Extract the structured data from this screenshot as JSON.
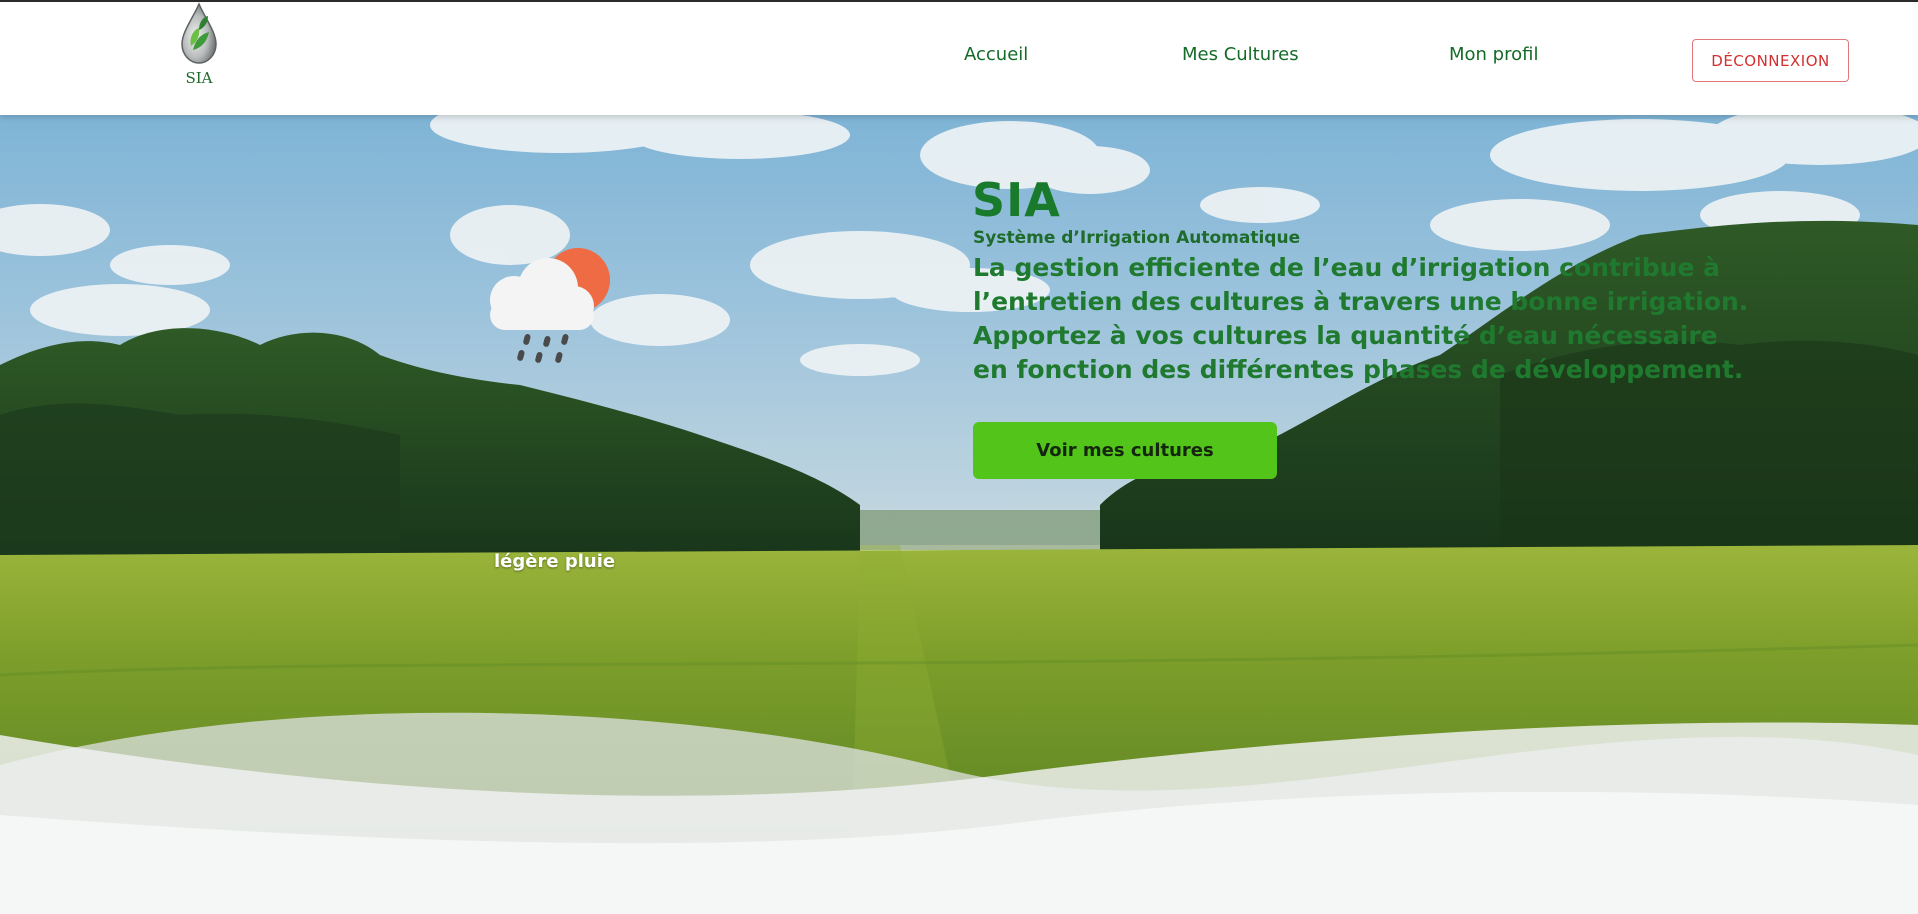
{
  "navbar": {
    "logo_text": "SIA",
    "links": [
      "Accueil",
      "Mes Cultures",
      "Mon profil"
    ],
    "logout_label": "DÉCONNEXION"
  },
  "weather": {
    "icon": "sun-cloud-rain-icon",
    "label": "légère pluie"
  },
  "hero": {
    "title": "SIA",
    "subtitle": "Système d’Irrigation Automatique",
    "description": "La gestion efficiente de l’eau d’irrigation contribue à l’entretien des cultures à travers une bonne irrigation. Apportez à vos cultures la quantité d’eau nécessaire en fonction des différentes phases de développement.",
    "button_label": "Voir mes cultures"
  },
  "colors": {
    "brand_green": "#1a7a2c",
    "button_green": "#52c41a",
    "logout_red": "#d32f2f"
  }
}
